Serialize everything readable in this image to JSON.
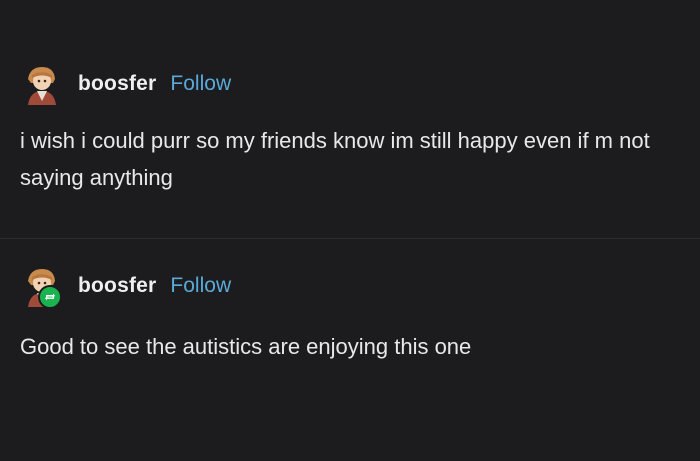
{
  "posts": [
    {
      "username": "boosfer",
      "follow_label": "Follow",
      "text": "i wish i could purr so my friends know im still happy even if m not saying anything",
      "avatar_icon": "anime-girl-avatar"
    },
    {
      "username": "boosfer",
      "follow_label": "Follow",
      "text": "Good to see the autistics are enjoying this one",
      "avatar_icon": "anime-girl-avatar",
      "badge_icon": "reblog-icon",
      "badge_color": "#19b34f"
    }
  ],
  "colors": {
    "background": "#1c1c1e",
    "text": "#e8e8e8",
    "follow": "#5aa9d9"
  }
}
